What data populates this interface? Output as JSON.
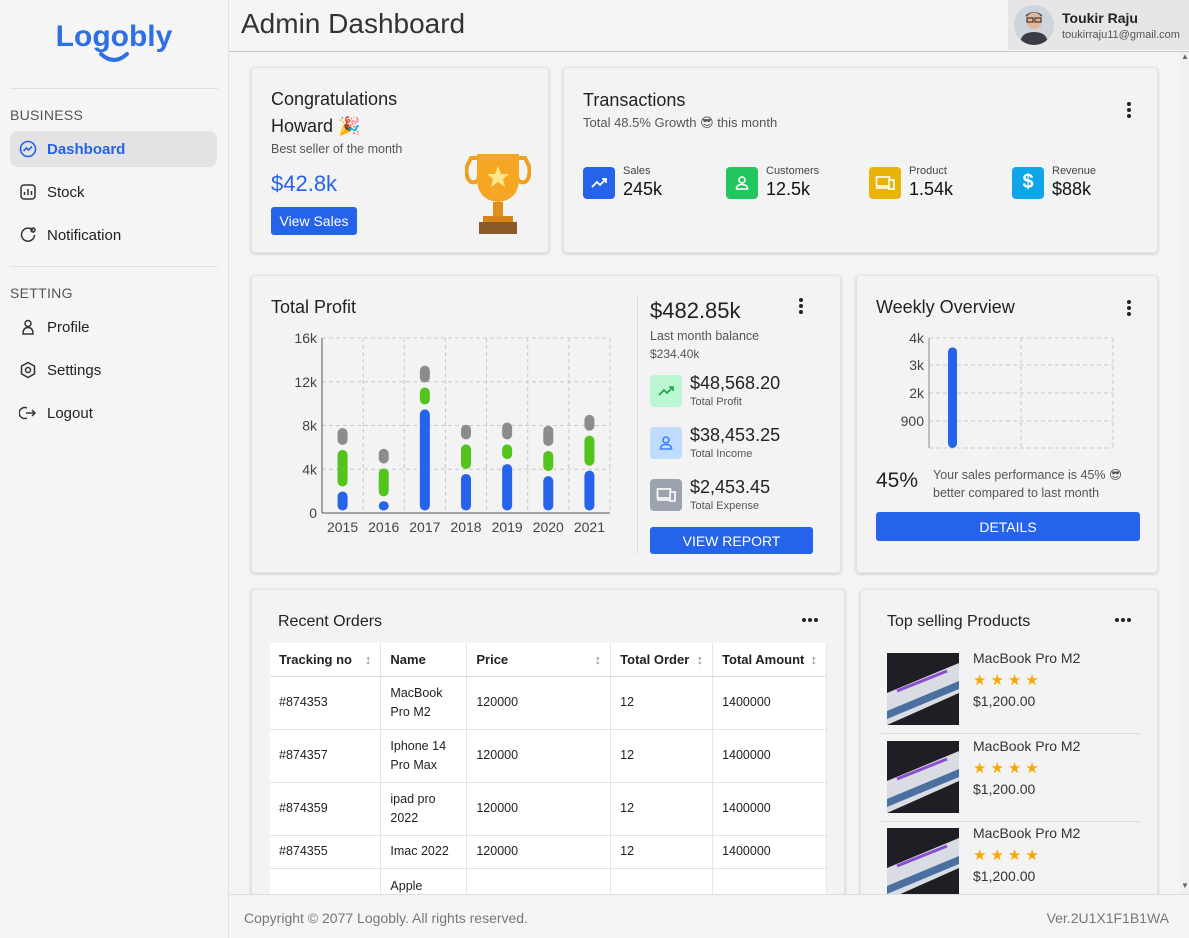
{
  "brand": {
    "logo_text": "Logobly"
  },
  "sidebar": {
    "sections": [
      {
        "title": "BUSINESS",
        "items": [
          {
            "label": "Dashboard",
            "icon": "chart-line-icon",
            "active": true
          },
          {
            "label": "Stock",
            "icon": "stock-chart-icon",
            "active": false
          },
          {
            "label": "Notification",
            "icon": "notification-icon",
            "active": false
          }
        ]
      },
      {
        "title": "SETTING",
        "items": [
          {
            "label": "Profile",
            "icon": "person-icon",
            "active": false
          },
          {
            "label": "Settings",
            "icon": "settings-icon",
            "active": false
          },
          {
            "label": "Logout",
            "icon": "logout-icon",
            "active": false
          }
        ]
      }
    ]
  },
  "header": {
    "title": "Admin Dashboard",
    "user": {
      "name": "Toukir Raju",
      "email": "toukirraju11@gmail.com"
    }
  },
  "congrats": {
    "title_line1": "Congratulations",
    "title_line2": "Howard",
    "emoji": "🎉",
    "subtitle": "Best seller of the month",
    "amount": "$42.8k",
    "button": "View Sales"
  },
  "transactions": {
    "title": "Transactions",
    "subtitle_prefix": "Total 48.5% Growth",
    "emoji": "😎",
    "subtitle_suffix": "this month",
    "stats": [
      {
        "label": "Sales",
        "value": "245k",
        "color": "#2563eb",
        "icon": "trending-up-icon"
      },
      {
        "label": "Customers",
        "value": "12.5k",
        "color": "#22c55e",
        "icon": "person-icon"
      },
      {
        "label": "Product",
        "value": "1.54k",
        "color": "#eab308",
        "icon": "devices-icon"
      },
      {
        "label": "Revenue",
        "value": "$88k",
        "color": "#0ea5e9",
        "icon": "dollar-icon"
      }
    ]
  },
  "total_profit": {
    "title": "Total Profit",
    "balance": "$482.85k",
    "balance_label": "Last month balance",
    "balance_sub": "$234.40k",
    "items": [
      {
        "value": "$48,568.20",
        "label": "Total Profit",
        "bg": "#bbf7d0",
        "fg": "#16a34a",
        "icon": "trending-up-icon"
      },
      {
        "value": "$38,453.25",
        "label": "Total Income",
        "bg": "#bfdbfe",
        "fg": "#3b82f6",
        "icon": "person-icon"
      },
      {
        "value": "$2,453.45",
        "label": "Total Expense",
        "bg": "#9ca3af",
        "fg": "#ffffff",
        "icon": "devices-icon"
      }
    ],
    "button": "VIEW REPORT"
  },
  "weekly": {
    "title": "Weekly Overview",
    "percent": "45%",
    "text_line1": "Your sales performance is 45%",
    "emoji": "😎",
    "text_line2": "better compared to last month",
    "button": "DETAILS"
  },
  "chart_data": [
    {
      "type": "bar",
      "title": "Total Profit",
      "categories": [
        "2015",
        "2016",
        "2017",
        "2018",
        "2019",
        "2020",
        "2021"
      ],
      "yticks": [
        "0",
        "4k",
        "8k",
        "12k",
        "16k"
      ],
      "ylim": [
        0,
        16000
      ],
      "grid": true,
      "stacked": true,
      "series": [
        {
          "values": [
            2200,
            1300,
            9700,
            3800,
            4700,
            3600,
            4100
          ],
          "color": "#2563eb"
        },
        {
          "values": [
            3800,
            3000,
            2000,
            2700,
            1800,
            2300,
            3200
          ],
          "color": "#52c41a"
        },
        {
          "values": [
            2000,
            1800,
            2000,
            1800,
            2000,
            2300,
            1900
          ],
          "color": "#8c8c8c"
        }
      ]
    },
    {
      "type": "bar",
      "title": "Weekly Overview",
      "yticks": [
        "900",
        "2k",
        "3k",
        "4k"
      ],
      "grid": true,
      "series": [
        {
          "values": [
            3800
          ],
          "color": "#2563eb"
        }
      ]
    }
  ],
  "recent_orders": {
    "title": "Recent Orders",
    "columns": [
      "Tracking no",
      "Name",
      "Price",
      "Total Order",
      "Total Amount"
    ],
    "rows": [
      {
        "tracking": "#874353",
        "name_l1": "MacBook",
        "name_l2": "Pro M2",
        "price": "120000",
        "total_order": "12",
        "total_amount": "1400000"
      },
      {
        "tracking": "#874357",
        "name_l1": "Iphone 14",
        "name_l2": "Pro Max",
        "price": "120000",
        "total_order": "12",
        "total_amount": "1400000"
      },
      {
        "tracking": "#874359",
        "name_l1": "ipad pro",
        "name_l2": "2022",
        "price": "120000",
        "total_order": "12",
        "total_amount": "1400000"
      },
      {
        "tracking": "#874355",
        "name_l1": "Imac 2022",
        "name_l2": "",
        "price": "120000",
        "total_order": "12",
        "total_amount": "1400000"
      },
      {
        "tracking": "",
        "name_l1": "Apple",
        "name_l2": "",
        "price": "",
        "total_order": "",
        "total_amount": ""
      }
    ]
  },
  "top_products": {
    "title": "Top selling Products",
    "items": [
      {
        "name": "MacBook Pro M2",
        "stars": "★★★★",
        "price": "$1,200.00"
      },
      {
        "name": "MacBook Pro M2",
        "stars": "★★★★",
        "price": "$1,200.00"
      },
      {
        "name": "MacBook Pro M2",
        "stars": "★★★★",
        "price": "$1,200.00"
      }
    ]
  },
  "footer": {
    "copyright": "Copyright © 2077 Logobly. All rights reserved.",
    "version": "Ver.2U1X1F1B1WA"
  }
}
